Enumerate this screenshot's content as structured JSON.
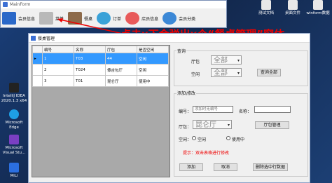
{
  "main": {
    "title": "MainForm",
    "nav": [
      {
        "label": "会员信息"
      },
      {
        "label": "菜单"
      },
      {
        "label": "餐桌"
      },
      {
        "label": "订单"
      },
      {
        "label": "店员信息"
      },
      {
        "label": "会员分类"
      }
    ]
  },
  "annotation": "点击x下会弹出x个“餐桌管理”窗体",
  "desktop": {
    "left": [
      {
        "label": "IntelliJ IDEA 2020.1.3 x64"
      },
      {
        "label": "Microsoft Edge"
      },
      {
        "label": "Microsoft Visual Stu..."
      },
      {
        "label": "MiLi"
      }
    ],
    "right": [
      {
        "label": "测试文档"
      },
      {
        "label": "桌面文件"
      },
      {
        "label": "winform数据"
      }
    ]
  },
  "child": {
    "title": "餐桌管理",
    "table": {
      "headers": [
        "编号",
        "名称",
        "厅包",
        "是否空闲"
      ],
      "rows": [
        [
          "1",
          "T03",
          "44",
          "空闲"
        ],
        [
          "2",
          "T024",
          "傣吉包厅",
          "空闲"
        ],
        [
          "3",
          "T01",
          "昆仑厅",
          "使用中"
        ]
      ]
    },
    "query": {
      "group_label": "查询",
      "hall_label": "厅包",
      "hall_value": "全部",
      "status_label": "空闲",
      "status_value": "全部",
      "query_all_button": "查询全部"
    },
    "edit": {
      "group_label": "添加\\修改",
      "number_label": "编号：",
      "number_placeholder": "添加时无编号",
      "name_label": "名称：",
      "hall_label": "厅包：",
      "hall_value": "昆仑厅",
      "hall_manage_button": "厅包管理",
      "status_label": "空闲：",
      "radio_free": "空闲",
      "radio_busy": "使用中",
      "hint": "提示：双击表格进行修改",
      "add_button": "添加",
      "cancel_button": "取消",
      "delete_button": "删除选中行数据"
    }
  }
}
